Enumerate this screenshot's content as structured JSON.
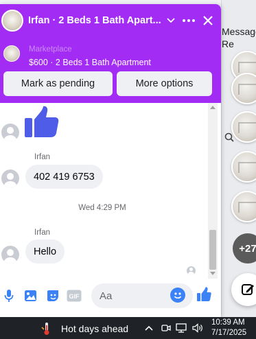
{
  "background": {
    "header_text_1": "Message",
    "header_text_2": "Re",
    "more_count": "+27"
  },
  "chat": {
    "title": "Irfan · 2 Beds 1 Bath Apart...",
    "listing": {
      "source": "Marketplace",
      "title": "$600 · 2 Beds 1 Bath Apartment"
    },
    "buttons": {
      "mark_pending": "Mark as pending",
      "more_options": "More options"
    },
    "messages": [
      {
        "sender": "Irfan",
        "text": "402 419 6753"
      },
      {
        "sender": "Irfan",
        "text": "Hello"
      }
    ],
    "timestamp": "Wed 4:29 PM",
    "composer": {
      "placeholder": "Aa",
      "gif_label": "GIF"
    }
  },
  "taskbar": {
    "weather": "Hot days ahead",
    "time": "10:39 AM",
    "date": "7/17/2025"
  },
  "colors": {
    "header": "#a32cf5",
    "accent": "#3b82f6",
    "like": "#4f5ce8"
  }
}
